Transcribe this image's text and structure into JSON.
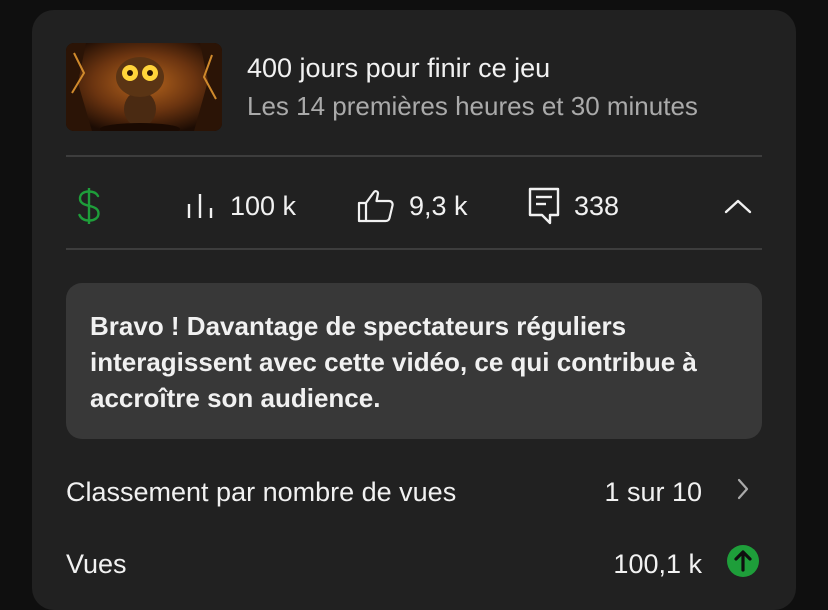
{
  "video": {
    "title": "400 jours pour finir ce jeu",
    "subtitle": "Les 14 premières heures et 30 minutes",
    "thumbnail_icon": "game-thumbnail"
  },
  "stats": {
    "monetization_icon": "dollar-icon",
    "views_icon": "bar-chart-icon",
    "views": "100 k",
    "likes_icon": "thumbs-up-icon",
    "likes": "9,3 k",
    "comments_icon": "comment-icon",
    "comments": "338",
    "collapse_icon": "chevron-up-icon"
  },
  "callout": {
    "text": "Bravo ! Davantage de spectateurs réguliers interagissent avec cette vidéo, ce qui contribue à accroître son audience."
  },
  "metrics": {
    "ranking_label": "Classement par nombre de vues",
    "ranking_value": "1 sur 10",
    "views_label": "Vues",
    "views_value": "100,1 k"
  },
  "colors": {
    "card_bg": "#212121",
    "callout_bg": "#383838",
    "accent_green": "#1e9e3a",
    "muted_text": "#aaaaaa"
  }
}
